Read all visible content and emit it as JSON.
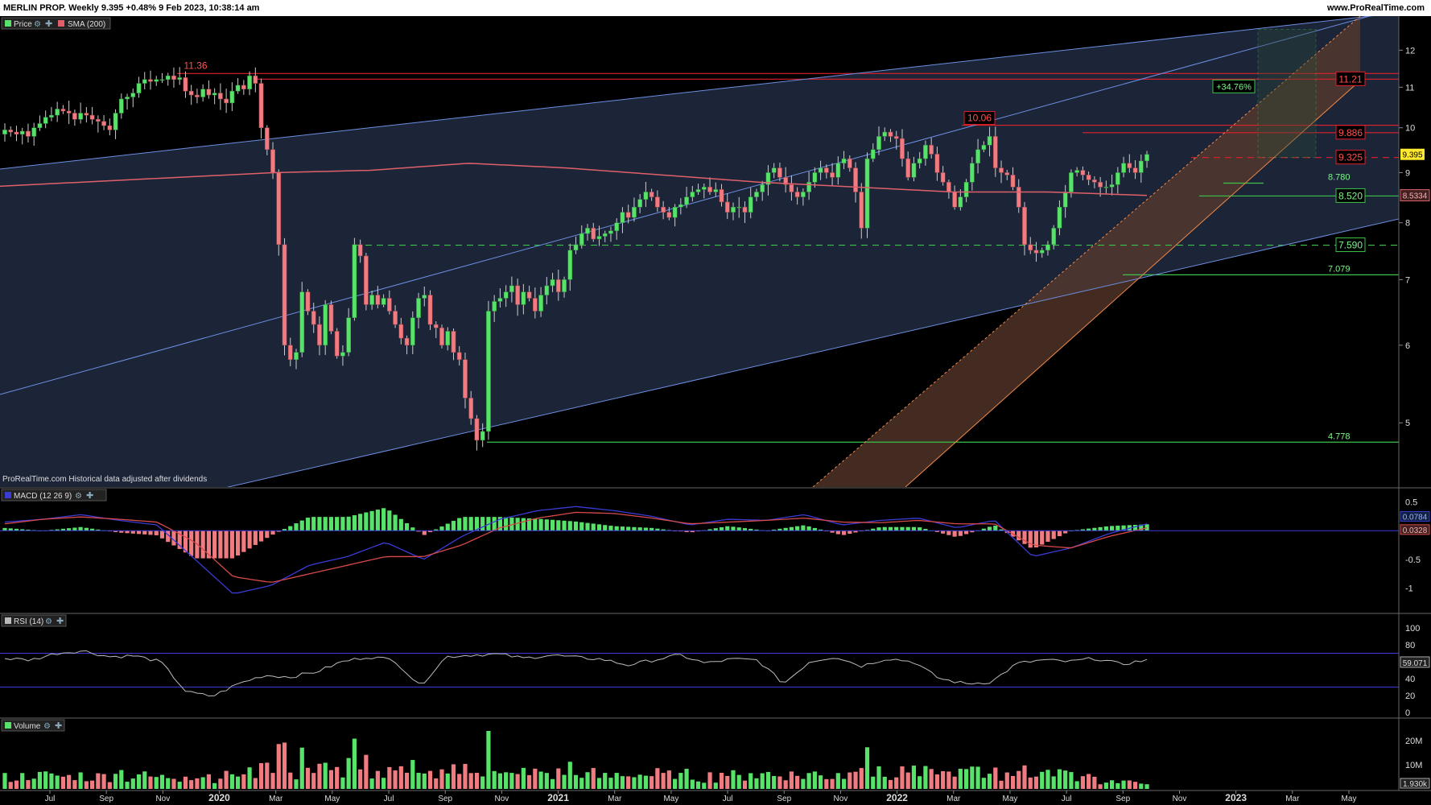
{
  "header": {
    "title": "MERLIN PROP. Weekly 9.395 +0.48% 9 Feb 2023, 10:38:14 am",
    "brand": "www.ProRealTime.com"
  },
  "panels": {
    "price": {
      "label": "Price",
      "sma_label": "SMA (200)",
      "footnote": "ProRealTime.com Historical data adjusted after dividends"
    },
    "macd": {
      "label": "MACD (12 26 9)"
    },
    "rsi": {
      "label": "RSI (14)"
    },
    "volume": {
      "label": "Volume"
    }
  },
  "colors": {
    "up": "#57e36a",
    "down": "#f07b80",
    "sma": "#e0606a",
    "channel_line": "#6c8fe0",
    "channel_fill": "#1c2438",
    "orange_fill": "#5a3a2c",
    "orange_line": "#f08a4a",
    "resistance": "#e0202a",
    "support": "#3cc24a",
    "macd_line": "#3b3bd6",
    "signal_line": "#d84a4a",
    "rsi_line": "#bbbbbb",
    "rsi_band": "#3b3bd6",
    "current": "#ffe830"
  },
  "chart_data": [
    {
      "type": "candlestick",
      "panel": "price",
      "scale": "log",
      "ylim": [
        4.3,
        13
      ],
      "yticks": [
        5,
        6,
        7,
        8,
        9,
        10,
        11,
        12
      ],
      "xlabels": [
        "Jul",
        "Sep",
        "Nov",
        "2020",
        "Mar",
        "May",
        "Jul",
        "Sep",
        "Nov",
        "2021",
        "Mar",
        "May",
        "Jul",
        "Sep",
        "Nov",
        "2022",
        "Mar",
        "May",
        "Jul",
        "Sep",
        "Nov",
        "2023",
        "Mar",
        "May"
      ],
      "bar_interval": "weekly",
      "closes": [
        9.95,
        9.9,
        9.85,
        9.92,
        9.8,
        10.0,
        10.1,
        10.25,
        10.3,
        10.45,
        10.4,
        10.35,
        10.2,
        10.35,
        10.3,
        10.2,
        10.15,
        10.05,
        9.95,
        10.35,
        10.7,
        10.75,
        10.85,
        11.1,
        11.2,
        11.15,
        11.2,
        11.2,
        11.3,
        11.2,
        11.25,
        10.9,
        10.8,
        10.75,
        10.95,
        10.8,
        10.85,
        10.7,
        10.6,
        10.9,
        11.05,
        10.95,
        11.3,
        11.1,
        10.0,
        9.5,
        9.0,
        7.6,
        6.0,
        5.8,
        5.9,
        6.8,
        6.5,
        6.3,
        6.0,
        6.6,
        6.2,
        5.85,
        5.9,
        6.4,
        7.6,
        7.4,
        6.6,
        6.75,
        6.6,
        6.7,
        6.5,
        6.3,
        6.1,
        6.0,
        6.4,
        6.7,
        6.75,
        6.3,
        6.25,
        6.0,
        6.2,
        5.9,
        5.8,
        5.3,
        5.05,
        4.8,
        4.9,
        6.5,
        6.65,
        6.7,
        6.8,
        6.9,
        6.6,
        6.8,
        6.7,
        6.5,
        6.75,
        6.9,
        7.0,
        6.8,
        7.0,
        7.5,
        7.6,
        7.8,
        7.9,
        7.7,
        7.75,
        7.8,
        7.85,
        8.0,
        8.2,
        8.1,
        8.3,
        8.45,
        8.6,
        8.5,
        8.3,
        8.2,
        8.1,
        8.3,
        8.35,
        8.5,
        8.6,
        8.65,
        8.7,
        8.6,
        8.65,
        8.4,
        8.2,
        8.3,
        8.3,
        8.2,
        8.5,
        8.6,
        8.75,
        9.0,
        9.1,
        8.9,
        8.75,
        8.6,
        8.5,
        8.6,
        8.8,
        9.0,
        9.1,
        9.0,
        8.9,
        9.2,
        9.3,
        9.1,
        8.6,
        7.9,
        9.3,
        9.5,
        9.8,
        9.9,
        9.8,
        9.75,
        9.3,
        8.9,
        9.2,
        9.3,
        9.6,
        9.4,
        9.0,
        8.8,
        8.6,
        8.3,
        8.5,
        8.8,
        9.2,
        9.5,
        9.6,
        9.8,
        9.1,
        9.0,
        8.95,
        8.7,
        8.3,
        7.6,
        7.5,
        7.45,
        7.5,
        7.6,
        7.9,
        8.3,
        8.6,
        9.0,
        9.05,
        8.95,
        8.85,
        8.8,
        8.7,
        8.7,
        8.75,
        9.0,
        9.2,
        9.1,
        9.0,
        9.25,
        9.395
      ],
      "sma200_anchors": [
        8.7,
        8.8,
        8.9,
        9.0,
        9.05,
        9.2,
        9.1,
        8.95,
        8.8,
        8.7,
        8.6,
        8.6,
        8.53
      ],
      "levels": [
        {
          "value": 11.36,
          "label": "11.36",
          "kind": "resistance",
          "label_pos": "left"
        },
        {
          "value": 11.21,
          "label": "11.21",
          "kind": "resistance",
          "label_pos": "right-box"
        },
        {
          "value": 10.06,
          "label": "10.06",
          "kind": "resistance",
          "label_pos": "left-box"
        },
        {
          "value": 9.886,
          "label": "9.886",
          "kind": "resistance",
          "label_pos": "right-box"
        },
        {
          "value": 9.325,
          "label": "9.325",
          "kind": "resistance",
          "label_pos": "right-box"
        },
        {
          "value": 8.78,
          "label": "8.780",
          "kind": "support",
          "label_pos": "right"
        },
        {
          "value": 8.52,
          "label": "8.520",
          "kind": "support",
          "label_pos": "right-box"
        },
        {
          "value": 7.59,
          "label": "7.590",
          "kind": "support",
          "label_pos": "right-box"
        },
        {
          "value": 7.079,
          "label": "7.079",
          "kind": "support",
          "label_pos": "right"
        },
        {
          "value": 4.778,
          "label": "4.778",
          "kind": "support",
          "label_pos": "right"
        }
      ],
      "target_box": {
        "label": "+34.76%",
        "from": 9.325,
        "to": 12.6
      },
      "current_price": {
        "value": 9.395,
        "label": "9.395"
      },
      "sma_value": {
        "value": 8.5334,
        "label": "8.5334"
      }
    },
    {
      "type": "macd",
      "panel": "macd",
      "ylim": [
        -1.2,
        0.55
      ],
      "yticks": [
        0.5,
        -0.5,
        -1
      ],
      "ytick_labels": [
        "0.5",
        "-0.5",
        "-1"
      ],
      "macd_anchors": [
        0.15,
        0.2,
        0.28,
        0.18,
        0.1,
        -0.5,
        -1.1,
        -0.95,
        -0.6,
        -0.45,
        -0.2,
        -0.5,
        -0.1,
        0.2,
        0.35,
        0.42,
        0.35,
        0.25,
        0.1,
        0.2,
        0.18,
        0.28,
        0.1,
        0.18,
        0.22,
        0.05,
        0.18,
        -0.45,
        -0.3,
        -0.05,
        0.12
      ],
      "signal_anchors": [
        0.12,
        0.2,
        0.24,
        0.2,
        0.15,
        -0.2,
        -0.8,
        -0.9,
        -0.75,
        -0.6,
        -0.45,
        -0.45,
        -0.25,
        0.05,
        0.22,
        0.32,
        0.3,
        0.22,
        0.12,
        0.15,
        0.18,
        0.22,
        0.15,
        0.14,
        0.18,
        0.12,
        0.12,
        -0.25,
        -0.3,
        -0.1,
        0.05
      ],
      "value_labels": [
        {
          "value": 0.0784,
          "label": "0.0784"
        },
        {
          "value": 0.0328,
          "label": "0.0328"
        }
      ]
    },
    {
      "type": "line",
      "panel": "rsi",
      "ylim": [
        0,
        100
      ],
      "yticks": [
        100,
        80,
        60,
        40,
        20,
        0
      ],
      "bands": [
        70,
        30
      ],
      "rsi_anchors": [
        64,
        62,
        70,
        73,
        66,
        67,
        60,
        24,
        19,
        34,
        44,
        42,
        48,
        60,
        66,
        62,
        31,
        66,
        68,
        69,
        64,
        68,
        65,
        63,
        56,
        62,
        68,
        58,
        63,
        62,
        34,
        60,
        66,
        55,
        64,
        60,
        40,
        34,
        36,
        58,
        62,
        60,
        64,
        57,
        62
      ],
      "current": {
        "value": 59.071,
        "label": "59.071"
      }
    },
    {
      "type": "bar",
      "panel": "volume",
      "ylim": [
        0,
        25
      ],
      "yticks": [
        20,
        10
      ],
      "ytick_labels": [
        "20M",
        "10M"
      ],
      "unit": "M",
      "current": {
        "value": 1.93,
        "label": "1.930k"
      }
    }
  ]
}
